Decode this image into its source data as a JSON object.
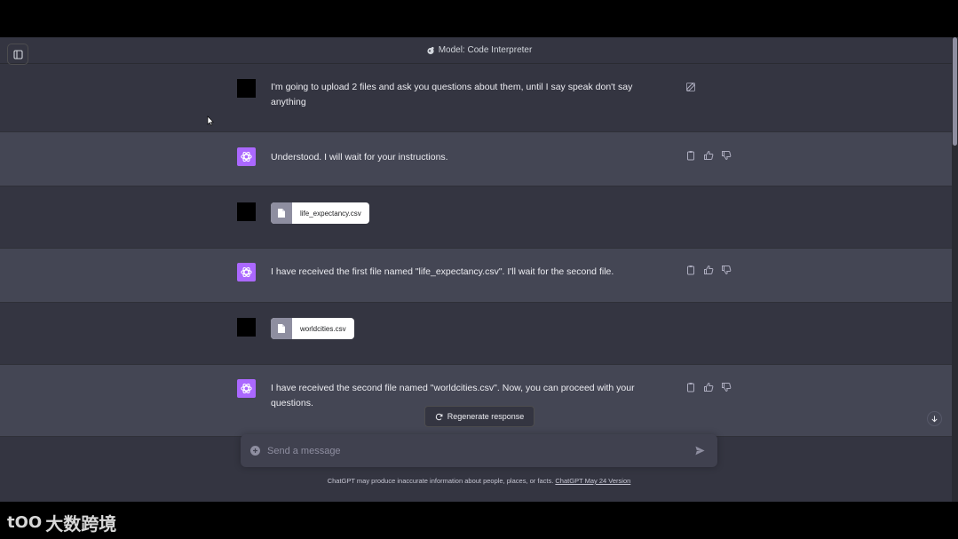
{
  "header": {
    "model_label": "Model: Code Interpreter"
  },
  "messages": [
    {
      "role": "user",
      "text": "I'm going to upload 2 files and ask you questions about them, until I say speak don't say anything"
    },
    {
      "role": "assistant",
      "text": "Understood. I will wait for your instructions."
    },
    {
      "role": "user",
      "file": "life_expectancy.csv"
    },
    {
      "role": "assistant",
      "text": "I have received the first file named \"life_expectancy.csv\". I'll wait for the second file."
    },
    {
      "role": "user",
      "file": "worldcities.csv"
    },
    {
      "role": "assistant",
      "text": "I have received the second file named \"worldcities.csv\". Now, you can proceed with your questions."
    }
  ],
  "regenerate_label": "Regenerate response",
  "composer": {
    "placeholder": "Send a message"
  },
  "footer": {
    "note": "ChatGPT may produce inaccurate information about people, places, or facts.",
    "version_link": "ChatGPT May 24 Version"
  },
  "watermark": {
    "logo": "tOO",
    "text": "大数跨境"
  },
  "colors": {
    "background": "#343541",
    "assistant_row": "#444654",
    "gpt_avatar": "#ab68ff",
    "composer": "#40414f"
  }
}
